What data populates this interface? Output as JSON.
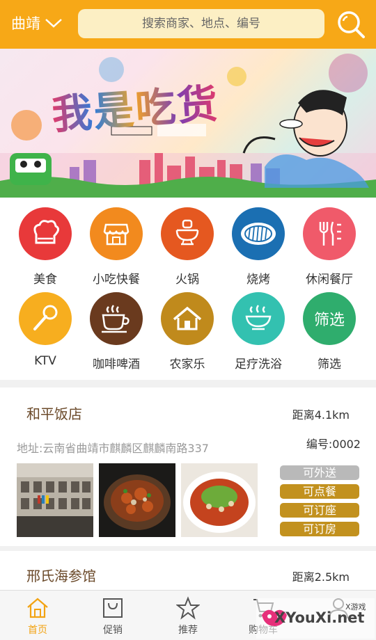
{
  "header": {
    "city": "曲靖",
    "search_placeholder": "搜索商家、地点、编号"
  },
  "banner": {
    "title": "我是吃货"
  },
  "categories": [
    {
      "label": "美食",
      "color": "#e8393a",
      "icon": "chef-hat-icon"
    },
    {
      "label": "小吃快餐",
      "color": "#f28a1e",
      "icon": "shop-icon"
    },
    {
      "label": "火锅",
      "color": "#e55820",
      "icon": "hotpot-icon"
    },
    {
      "label": "烧烤",
      "color": "#1b6fb2",
      "icon": "grill-icon"
    },
    {
      "label": "休闲餐厅",
      "color": "#f05a6a",
      "icon": "cutlery-icon"
    },
    {
      "label": "KTV",
      "color": "#f7ae1f",
      "icon": "microphone-icon"
    },
    {
      "label": "咖啡啤酒",
      "color": "#6a3a1e",
      "icon": "coffee-cup-icon"
    },
    {
      "label": "农家乐",
      "color": "#c08a1c",
      "icon": "house-icon"
    },
    {
      "label": "足疗洗浴",
      "color": "#33c1b0",
      "icon": "basin-icon"
    },
    {
      "label": "筛选",
      "color": "#2fad6d",
      "icon": "filter-text",
      "circle_text": "筛选"
    }
  ],
  "shops": [
    {
      "name": "和平饭店",
      "distance": "距离4.1km",
      "address": "地址:云南省曲靖市麒麟区麒麟南路337",
      "number": "编号:0002",
      "tags": [
        {
          "label": "可外送",
          "color": "#b9b9b9"
        },
        {
          "label": "可点餐",
          "color": "#c2911e"
        },
        {
          "label": "可订座",
          "color": "#c2911e"
        },
        {
          "label": "可订房",
          "color": "#c2911e"
        }
      ]
    },
    {
      "name": "邢氏海参馆",
      "distance": "距离2.5km"
    }
  ],
  "nav": {
    "items": [
      {
        "label": "首页",
        "icon": "home-icon",
        "active": true
      },
      {
        "label": "促销",
        "icon": "bag-icon"
      },
      {
        "label": "推荐",
        "icon": "star-icon"
      },
      {
        "label": "购物车",
        "icon": "cart-icon"
      },
      {
        "label": "",
        "icon": "user-icon"
      }
    ]
  },
  "watermark": {
    "text": "XYouXi.net",
    "small": "X游戏"
  },
  "colors": {
    "header": "#f7a817",
    "active_nav": "#f2a313"
  }
}
